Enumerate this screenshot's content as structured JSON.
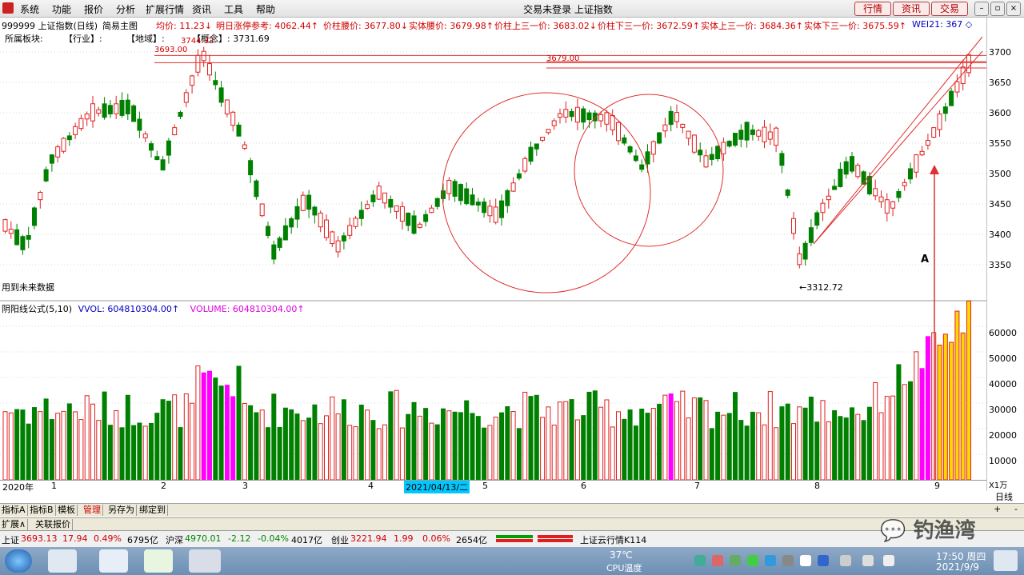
{
  "menu": {
    "items": [
      "系统",
      "功能",
      "报价",
      "分析",
      "扩展行情",
      "资讯",
      "工具",
      "帮助"
    ],
    "window_title": "交易未登录 上证指数",
    "buttons": [
      "行情",
      "资讯",
      "交易"
    ]
  },
  "info_bar": {
    "code": "999999 上证指数(日线)",
    "mode": "简易主图",
    "avg_price": "均价: 11.23↓",
    "next_limit": "明日涨停参考: 4062.44↑",
    "waist_price": "价柱腰价: 3677.80↓",
    "body_waist": "实体腰价: 3679.98↑",
    "upper_third": "价柱上三一价: 3683.02↓",
    "lower_third": "价柱下三一价: 3672.59↑",
    "body_upper_third": "实体上三一价: 3684.36↑",
    "body_lower_third": "实体下三一价: 3675.59↑",
    "wei": "WEI21: 367 ◇"
  },
  "info_row2": {
    "sector": "所属板块:",
    "industry": "【行业】:",
    "region": "【地域】:",
    "concept": "【概念】: 3731.69"
  },
  "annotations": {
    "line_3693": "3693.00",
    "line_3679": "3679.00",
    "label_3744": "3744.32",
    "low": "3312.72",
    "marker_a": "A",
    "future_note": "用到未来数据"
  },
  "price_axis": [
    "3700",
    "3650",
    "3600",
    "3550",
    "3500",
    "3450",
    "3400",
    "3350"
  ],
  "volume_axis": [
    "60000",
    "50000",
    "40000",
    "30000",
    "20000",
    "10000"
  ],
  "volume_unit": "X1万",
  "volume_header": {
    "formula": "阴阳线公式(5,10)",
    "vol": "VVOL: 604810304.00↑",
    "volume": "VOLUME: 604810304.00↑"
  },
  "date_axis": {
    "year": "2020年",
    "months": [
      "1",
      "2",
      "3",
      "4",
      "5",
      "6",
      "7",
      "8",
      "9"
    ],
    "highlight": "2021/04/13/二",
    "period": "日线"
  },
  "tabs": [
    "指标A",
    "指标B",
    "模板",
    "管理",
    "另存为",
    "绑定到"
  ],
  "tabs_row2": [
    "扩展∧",
    "关联报价"
  ],
  "status": {
    "sh_label": "上证",
    "sh_price": "3693.13",
    "sh_chg": "17.94",
    "sh_pct": "0.49%",
    "sh_amt": "6795亿",
    "hs_label": "沪深",
    "hs_price": "4970.01",
    "hs_chg": "-2.12",
    "hs_pct": "-0.04%",
    "hs_amt": "4017亿",
    "cy_label": "创业",
    "cy_price": "3221.94",
    "cy_chg": "1.99",
    "cy_pct": "0.06%",
    "cy_amt": "2654亿",
    "cloud": "上证云行情K114"
  },
  "watermark": "钓渔湾",
  "taskbar": {
    "temp": "37℃",
    "cpu": "CPU温度",
    "time": "17:50 周四",
    "date": "2021/9/9"
  },
  "colors": {
    "up": "#e02020",
    "down": "#008000",
    "highlight_bar": "#ffd700",
    "magenta_bar": "#ff00ff"
  }
}
